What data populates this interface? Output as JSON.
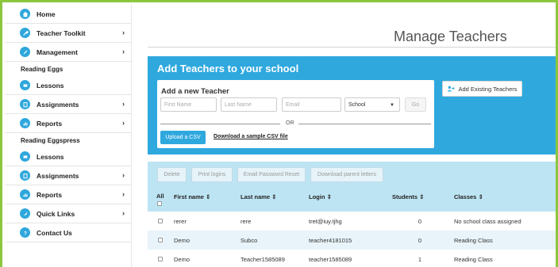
{
  "sidebar": {
    "home": "Home",
    "teacher_toolkit": "Teacher Toolkit",
    "management": "Management",
    "reading_eggs_heading": "Reading Eggs",
    "re_lessons": "Lessons",
    "re_assignments": "Assignments",
    "re_reports": "Reports",
    "eggspress_heading": "Reading Eggspress",
    "ep_lessons": "Lessons",
    "ep_assignments": "Assignments",
    "ep_reports": "Reports",
    "quick_links": "Quick Links",
    "contact_us": "Contact Us",
    "chevron": "›",
    "icon_color": "#2ea7dc"
  },
  "page": {
    "title": "Manage Teachers"
  },
  "add_panel": {
    "heading": "Add Teachers to your school",
    "subheading": "Add a new Teacher",
    "first_name_placeholder": "First Name",
    "last_name_placeholder": "Last Name",
    "email_placeholder": "Email",
    "school_select": "School",
    "go_label": "Go",
    "or_label": "OR",
    "upload_csv_label": "Upload a CSV",
    "sample_csv_link": "Download a sample CSV file",
    "add_existing_label": "Add Existing Teachers",
    "accent_color": "#2fa8de"
  },
  "toolbar": {
    "delete": "Delete",
    "print_logins": "Print logins",
    "email_password_reset": "Email Password Reset",
    "download_parent_letters": "Download parent letters"
  },
  "table": {
    "headers": {
      "all": "All",
      "first_name": "First name ⇕",
      "last_name": "Last name ⇕",
      "login": "Login ⇕",
      "students": "Students ⇕",
      "classes": "Classes ⇕"
    },
    "rows": [
      {
        "first_name": "rerer",
        "last_name": "rere",
        "login": "tret@iuy.tjhg",
        "students": "0",
        "classes": "No school class assigned"
      },
      {
        "first_name": "Demo",
        "last_name": "Subco",
        "login": "teacher4181015",
        "students": "0",
        "classes": "Reading Class"
      },
      {
        "first_name": "Demo",
        "last_name": "Teacher1585089",
        "login": "teacher1585089",
        "students": "1",
        "classes": "Reading Class"
      }
    ]
  }
}
